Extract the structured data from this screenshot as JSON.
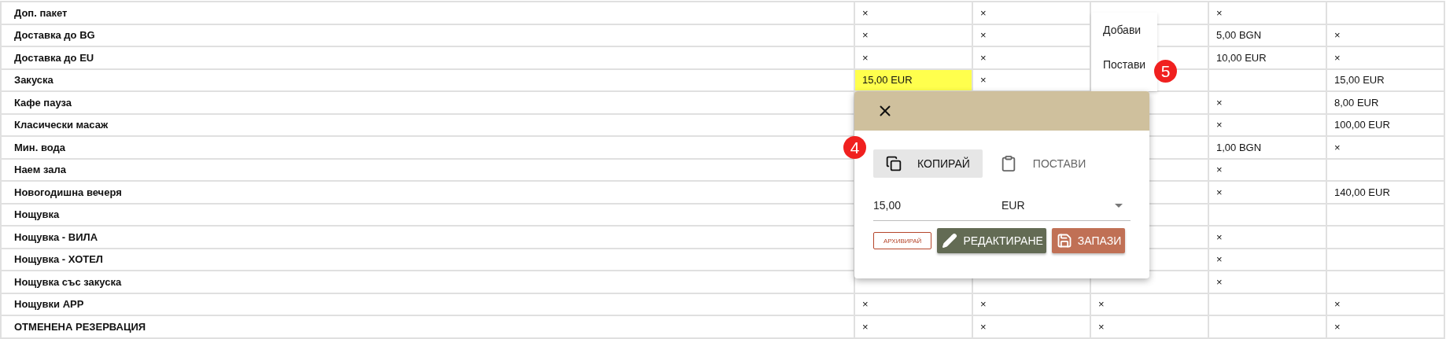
{
  "table": {
    "rows": [
      {
        "name": "Доп. пакет",
        "cells": [
          {
            "text": "×",
            "selected": false
          },
          {
            "text": "×",
            "selected": false
          },
          {
            "selected": false
          },
          {
            "text": "×",
            "selected": false
          },
          {
            "selected": false
          }
        ]
      },
      {
        "name": "Доставка до BG",
        "cells": [
          {
            "text": "×",
            "selected": false
          },
          {
            "text": "×",
            "selected": false
          },
          {
            "selected": false
          },
          {
            "text": "5,00 BGN",
            "selected": false
          },
          {
            "text": "×",
            "selected": false
          }
        ]
      },
      {
        "name": "Доставка до EU",
        "cells": [
          {
            "text": "×",
            "selected": false
          },
          {
            "text": "×",
            "selected": false
          },
          {
            "selected": false
          },
          {
            "text": "10,00 EUR",
            "selected": false
          },
          {
            "text": "×",
            "selected": false
          }
        ]
      },
      {
        "name": "Закуска",
        "cells": [
          {
            "text": "15,00 EUR",
            "selected": true
          },
          {
            "text": "×",
            "selected": false
          },
          {
            "selected": false
          },
          {
            "selected": false
          },
          {
            "text": "15,00 EUR",
            "selected": false
          }
        ]
      },
      {
        "name": "Кафе пауза",
        "cells": [
          null,
          null,
          {
            "selected": false
          },
          {
            "text": "×",
            "selected": false
          },
          {
            "text": "8,00 EUR",
            "selected": false
          }
        ]
      },
      {
        "name": "Класически масаж",
        "cells": [
          null,
          null,
          {
            "selected": false
          },
          {
            "text": "×",
            "selected": false
          },
          {
            "text": "100,00 EUR",
            "selected": false
          }
        ]
      },
      {
        "name": "Мин. вода",
        "cells": [
          null,
          null,
          {
            "selected": false
          },
          {
            "text": "1,00 BGN",
            "selected": false
          },
          {
            "text": "×",
            "selected": false
          }
        ]
      },
      {
        "name": "Наем зала",
        "cells": [
          null,
          null,
          {
            "selected": false
          },
          {
            "text": "×",
            "selected": false
          },
          {
            "selected": false
          }
        ]
      },
      {
        "name": "Новогодишна вечеря",
        "cells": [
          null,
          null,
          {
            "selected": false
          },
          {
            "text": "×",
            "selected": false
          },
          {
            "text": "140,00 EUR",
            "selected": false
          }
        ]
      },
      {
        "name": "Нощувка",
        "cells": [
          null,
          null,
          {
            "selected": false
          },
          {
            "selected": false
          },
          {
            "selected": false
          }
        ]
      },
      {
        "name": "Нощувка - ВИЛА",
        "cells": [
          null,
          null,
          {
            "selected": false
          },
          {
            "text": "×",
            "selected": false
          },
          {
            "selected": false
          }
        ]
      },
      {
        "name": "Нощувка - ХОТЕЛ",
        "cells": [
          null,
          null,
          {
            "selected": false
          },
          {
            "text": "×",
            "selected": false
          },
          {
            "selected": false
          }
        ]
      },
      {
        "name": "Нощувка със закуска",
        "cells": [
          {
            "selected": false
          },
          {
            "selected": false
          },
          {
            "selected": false
          },
          {
            "text": "×",
            "selected": false
          },
          {
            "selected": false
          }
        ]
      },
      {
        "name": "Нощувки APP",
        "cells": [
          {
            "text": "×",
            "selected": false
          },
          {
            "text": "×",
            "selected": false
          },
          {
            "text": "×",
            "selected": false
          },
          {
            "selected": false
          },
          {
            "text": "×",
            "selected": false
          }
        ]
      },
      {
        "name": "ОТМЕНЕНА РЕЗЕРВАЦИЯ",
        "cells": [
          {
            "text": "×",
            "selected": false
          },
          {
            "text": "×",
            "selected": false
          },
          {
            "text": "×",
            "selected": false
          },
          {
            "selected": false
          },
          {
            "text": "×",
            "selected": false
          }
        ]
      }
    ]
  },
  "context_menu": {
    "items": [
      {
        "label": "Добави"
      },
      {
        "label": "Постави"
      }
    ]
  },
  "popup": {
    "tools": [
      {
        "kind": "copy",
        "label": "КОПИРАЙ",
        "selected": true
      },
      {
        "kind": "paste",
        "label": "ПОСТАВИ",
        "selected": false
      }
    ],
    "amount": "15,00",
    "currency": "EUR",
    "actions": [
      {
        "kind": "archive",
        "label": "АРХИВИРАЙ"
      },
      {
        "kind": "edit",
        "label": "РЕДАКТИРАНЕ"
      },
      {
        "kind": "save",
        "label": "ЗАПАЗИ"
      }
    ]
  },
  "step_markers": [
    {
      "label": "4"
    },
    {
      "label": "5"
    }
  ]
}
